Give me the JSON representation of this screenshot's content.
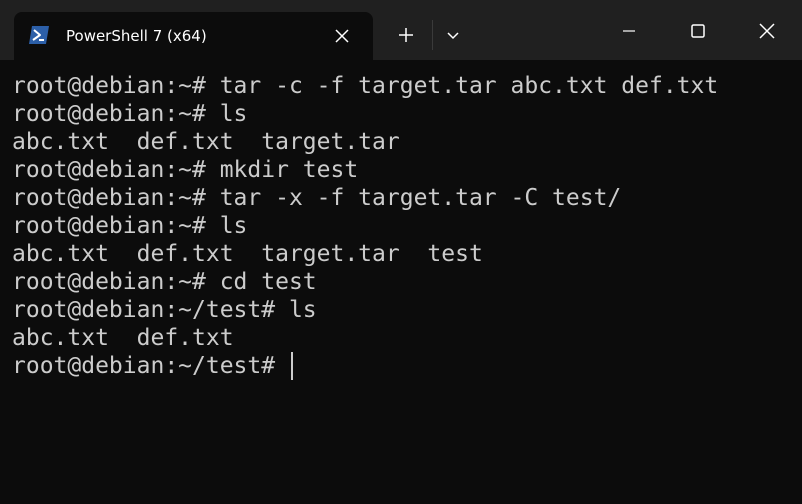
{
  "tab": {
    "title": "PowerShell 7 (x64)",
    "icon": "powershell-icon"
  },
  "icons": {
    "close_tab": "close-icon",
    "new_tab": "plus-icon",
    "dropdown": "chevron-down-icon",
    "minimize": "minimize-icon",
    "maximize": "maximize-icon",
    "close_window": "close-icon"
  },
  "colors": {
    "titlebar": "#202020",
    "terminal_bg": "#0c0c0c",
    "terminal_fg": "#cccccc",
    "tab_icon_bg": "#2c5fa8"
  },
  "terminal": {
    "lines": [
      "root@debian:~# tar -c -f target.tar abc.txt def.txt",
      "root@debian:~# ls",
      "abc.txt  def.txt  target.tar",
      "root@debian:~# mkdir test",
      "root@debian:~# tar -x -f target.tar -C test/",
      "root@debian:~# ls",
      "abc.txt  def.txt  target.tar  test",
      "root@debian:~# cd test",
      "root@debian:~/test# ls",
      "abc.txt  def.txt",
      "root@debian:~/test# "
    ]
  }
}
